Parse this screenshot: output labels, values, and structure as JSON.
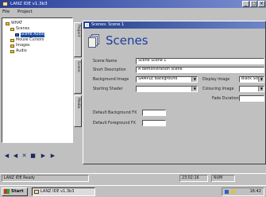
{
  "app": {
    "title": "LANZ IDE v1.3b3"
  },
  "menu": {
    "items": [
      "File",
      "Project"
    ]
  },
  "tree": {
    "items": [
      {
        "label": "WHAT",
        "indent": 0
      },
      {
        "label": "Scenes",
        "indent": 1
      },
      {
        "label": "Scene Audio",
        "indent": 2
      },
      {
        "label": "Mouse Cursors",
        "indent": 1
      },
      {
        "label": "Images",
        "indent": 1
      },
      {
        "label": "Audio",
        "indent": 1
      }
    ],
    "selected_index": 2
  },
  "side_tabs": [
    "Project",
    "Scene",
    "Media"
  ],
  "child_window": {
    "title": "Scenes: Scene 1"
  },
  "scenes": {
    "heading": "Scenes",
    "scene_name": {
      "label": "Scene Name",
      "value": "Scene Scene 1"
    },
    "short_description": {
      "label": "Short Description",
      "value": "A demonstration scene"
    },
    "background_image": {
      "label": "Background Image",
      "value": "SAMPLE Background"
    },
    "display_image": {
      "label": "Display Image",
      "value": "Black Scre"
    },
    "starting_shader": {
      "label": "Starting Shader",
      "value": ""
    },
    "colouring_image": {
      "label": "Colouring Image",
      "value": ""
    },
    "fade_duration": {
      "label": "Fade Duration",
      "value": ""
    },
    "sfx_background": {
      "label": "Default Background FX",
      "value": ""
    },
    "sfx_foreground": {
      "label": "Default Foreground FX",
      "value": ""
    }
  },
  "statusbar": {
    "left": "LANZ IDE Ready",
    "time": "23:02:16",
    "right": "NUM"
  },
  "taskbar": {
    "start_label": "Start",
    "task_label": "LANZ IDE v1.3b3",
    "clock": "16:42"
  }
}
